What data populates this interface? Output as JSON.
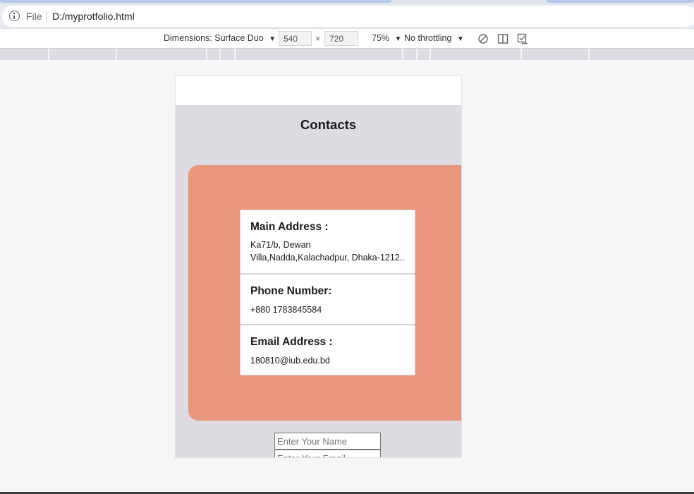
{
  "browser": {
    "scheme_label": "File",
    "url": "D:/myprotfolio.html"
  },
  "device_toolbar": {
    "dimensions_label": "Dimensions: Surface Duo",
    "width": "540",
    "height": "720",
    "times": "×",
    "zoom": "75%",
    "throttling": "No throttling"
  },
  "page": {
    "section_title": "Contacts",
    "cards": [
      {
        "title": "Main Address :",
        "value": "Ka71/b, Dewan Villa,Nadda,Kalachadpur, Dhaka-1212.."
      },
      {
        "title": "Phone Number:",
        "value": "+880 1783845584"
      },
      {
        "title": "Email Address :",
        "value": "180810@iub.edu.bd"
      }
    ],
    "form": {
      "name_placeholder": "Enter Your Name",
      "email_placeholder": "Enter Your Email"
    }
  }
}
